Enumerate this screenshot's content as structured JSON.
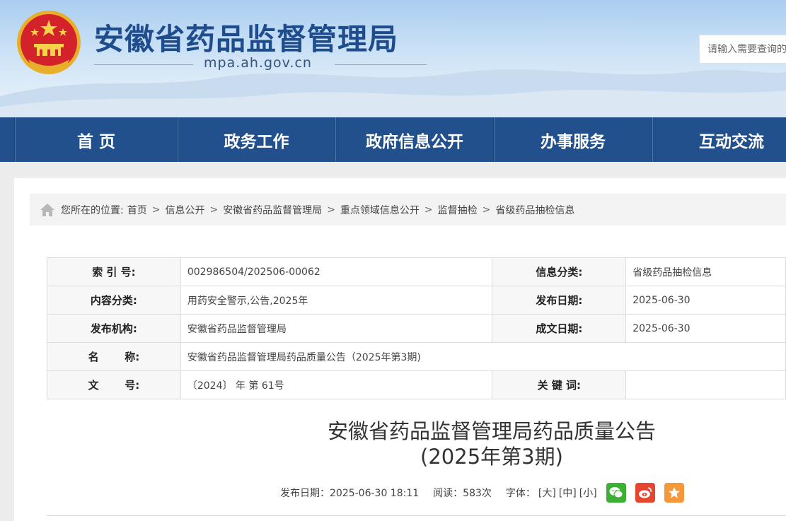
{
  "site": {
    "title": "安徽省药品监督管理局",
    "domain": "mpa.ah.gov.cn",
    "search_placeholder": "请输入需要查询的内容"
  },
  "nav": {
    "items": [
      "首 页",
      "政务工作",
      "政府信息公开",
      "办事服务",
      "互动交流"
    ]
  },
  "breadcrumb": {
    "prefix": "您所在的位置:",
    "items": [
      "首页",
      "信息公开",
      "安徽省药品监督管理局",
      "重点领域信息公开",
      "监督抽检",
      "省级药品抽检信息"
    ]
  },
  "info_table": {
    "index_label": "索 引 号:",
    "index_value": "002986504/202506-00062",
    "category_label": "信息分类:",
    "category_value": "省级药品抽检信息",
    "content_label": "内容分类:",
    "content_value": "用药安全警示,公告,2025年",
    "publish_date_label": "发布日期:",
    "publish_date_value": "2025-06-30",
    "org_label": "发布机构:",
    "org_value": "安徽省药品监督管理局",
    "created_date_label": "成文日期:",
    "created_date_value": "2025-06-30",
    "name_label": "名       称:",
    "name_value": "安徽省药品监督管理局药品质量公告（2025年第3期)",
    "doc_no_label": "文       号:",
    "doc_no_value": "〔2024〕 年 第 61号",
    "keywords_label": "关 键 词:",
    "keywords_value": ""
  },
  "article": {
    "title_line1": "安徽省药品监督管理局药品质量公告",
    "title_line2": "(2025年第3期)",
    "publish_label": "发布日期：2025-06-30 18:11",
    "views_label": "阅读：583次",
    "font_label": "字体：",
    "font_large": "[大]",
    "font_medium": "[中]",
    "font_small": "[小]"
  },
  "colors": {
    "nav_bg": "#21508d",
    "title_blue": "#1e4c8c",
    "wechat": "#3cb035",
    "weibo": "#e6452f",
    "favorite": "#f5983a"
  }
}
